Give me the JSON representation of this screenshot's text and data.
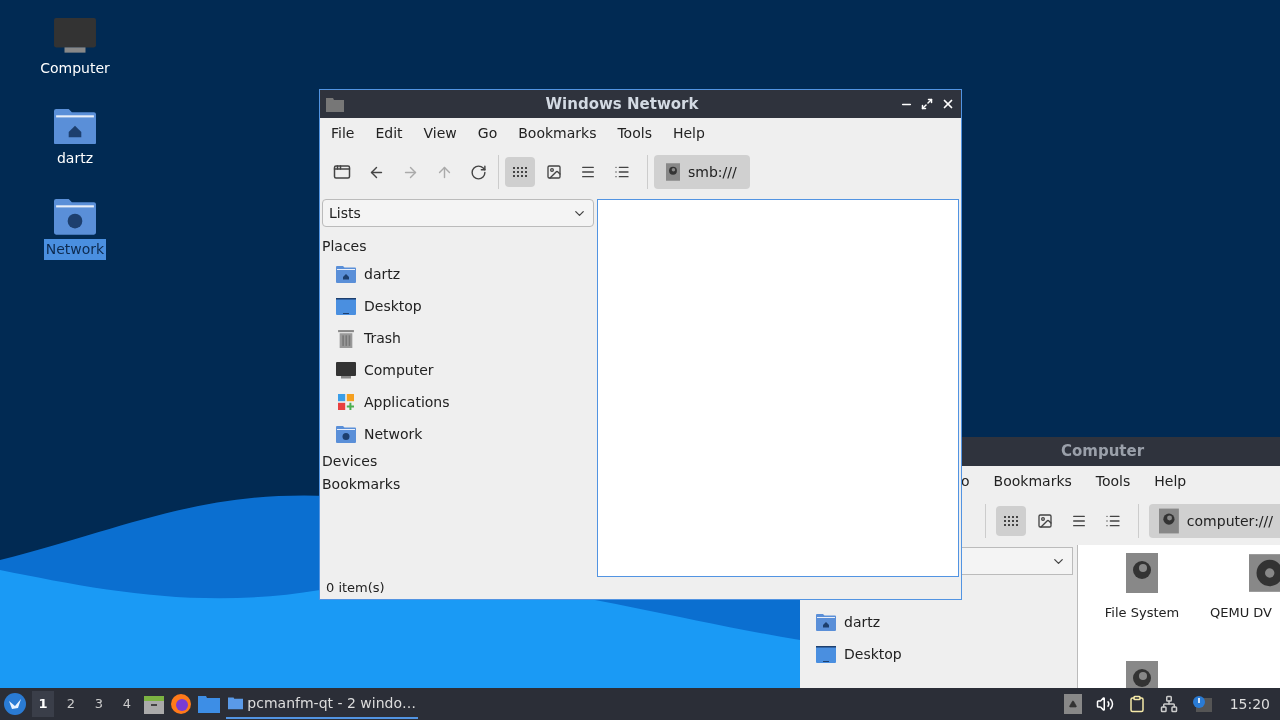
{
  "desktop_icons": [
    {
      "label": "Computer",
      "kind": "computer",
      "selected": false
    },
    {
      "label": "dartz",
      "kind": "home",
      "selected": false
    },
    {
      "label": "Network",
      "kind": "network",
      "selected": true
    }
  ],
  "front_window": {
    "title": "Windows Network",
    "menu": [
      "File",
      "Edit",
      "View",
      "Go",
      "Bookmarks",
      "Tools",
      "Help"
    ],
    "nav_buttons": [
      {
        "kind": "new-tab",
        "disabled": false
      },
      {
        "kind": "back",
        "disabled": false
      },
      {
        "kind": "forward",
        "disabled": true
      },
      {
        "kind": "up",
        "disabled": true
      },
      {
        "kind": "reload",
        "disabled": false
      }
    ],
    "view_buttons": [
      {
        "kind": "icons",
        "selected": true
      },
      {
        "kind": "thumbnails",
        "selected": false
      },
      {
        "kind": "compact",
        "selected": false
      },
      {
        "kind": "detailed",
        "selected": false
      }
    ],
    "location": "smb:///",
    "side_combo": "Lists",
    "sections": [
      {
        "label": "Places",
        "items": [
          {
            "label": "dartz",
            "kind": "home"
          },
          {
            "label": "Desktop",
            "kind": "desktop"
          },
          {
            "label": "Trash",
            "kind": "trash"
          },
          {
            "label": "Computer",
            "kind": "computer"
          },
          {
            "label": "Applications",
            "kind": "apps"
          },
          {
            "label": "Network",
            "kind": "network"
          }
        ]
      },
      {
        "label": "Devices"
      },
      {
        "label": "Bookmarks"
      }
    ],
    "status": "0 item(s)"
  },
  "back_window": {
    "title": "Computer",
    "menu": [
      "o",
      "Bookmarks",
      "Tools",
      "Help"
    ],
    "view_buttons": [
      {
        "kind": "icons",
        "selected": true
      },
      {
        "kind": "thumbnails",
        "selected": false
      },
      {
        "kind": "compact",
        "selected": false
      },
      {
        "kind": "detailed",
        "selected": false
      }
    ],
    "location": "computer:///",
    "places": [
      {
        "label": "dartz",
        "kind": "home"
      },
      {
        "label": "Desktop",
        "kind": "desktop"
      }
    ],
    "files": [
      {
        "label": "File System",
        "kind": "drive"
      },
      {
        "label": "QEMU DV",
        "kind": "optical"
      },
      {
        "kind": "drive"
      }
    ]
  },
  "taskbar": {
    "workspaces": [
      {
        "label": "1",
        "selected": true
      },
      {
        "label": "2",
        "selected": false
      },
      {
        "label": "3",
        "selected": false
      },
      {
        "label": "4",
        "selected": false
      }
    ],
    "tasks": [
      {
        "label": "pcmanfm-qt - 2 windo…",
        "selected": true
      }
    ],
    "clock": "15:20"
  }
}
